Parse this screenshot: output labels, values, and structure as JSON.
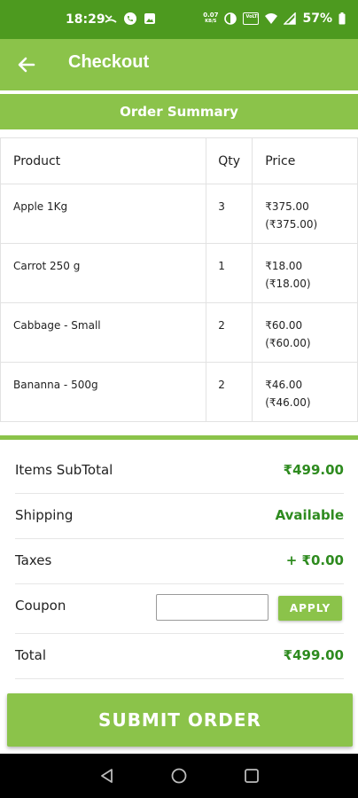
{
  "status_bar": {
    "time": "18:29",
    "data_rate": "0.07",
    "data_unit": "KB/S",
    "volte": "VoLTE",
    "battery": "57%"
  },
  "app_bar": {
    "title": "Checkout"
  },
  "summary": {
    "title": "Order Summary"
  },
  "table": {
    "headers": {
      "product": "Product",
      "qty": "Qty",
      "price": "Price"
    },
    "rows": [
      {
        "product": "Apple 1Kg",
        "qty": "3",
        "price": "₹375.00",
        "price_sub": "(₹375.00)"
      },
      {
        "product": "Carrot 250 g",
        "qty": "1",
        "price": "₹18.00",
        "price_sub": "(₹18.00)"
      },
      {
        "product": "Cabbage - Small",
        "qty": "2",
        "price": "₹60.00",
        "price_sub": "(₹60.00)"
      },
      {
        "product": "Bananna - 500g",
        "qty": "2",
        "price": "₹46.00",
        "price_sub": "(₹46.00)"
      }
    ]
  },
  "totals": {
    "subtotal_label": "Items SubTotal",
    "subtotal_value": "₹499.00",
    "shipping_label": "Shipping",
    "shipping_value": "Available",
    "taxes_label": "Taxes",
    "taxes_value": "+ ₹0.00",
    "coupon_label": "Coupon",
    "coupon_value": "",
    "coupon_placeholder": "",
    "apply_label": "APPLY",
    "total_label": "Total",
    "total_value": "₹499.00"
  },
  "submit": {
    "label": "SUBMIT ORDER"
  },
  "colors": {
    "status_bar": "#4d9a1f",
    "primary": "#8bc34a",
    "value_green": "#2e8b1f"
  },
  "icons": {
    "back": "arrow-left-icon",
    "nav_back": "triangle-back-icon",
    "nav_home": "circle-home-icon",
    "nav_recents": "square-recents-icon"
  }
}
